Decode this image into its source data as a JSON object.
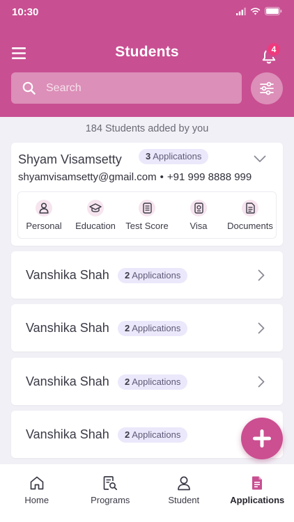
{
  "status_bar": {
    "time": "10:30"
  },
  "header": {
    "title": "Students",
    "notification_count": "4",
    "search": {
      "placeholder": "Search",
      "value": ""
    }
  },
  "summary": {
    "text": "184 Students added by you"
  },
  "expanded_student": {
    "name": "Shyam Visamsetty",
    "apps_count": "3",
    "apps_label": "Applications",
    "email": "shyamvisamsetty@gmail.com",
    "separator": "•",
    "phone": "+91 999 8888 999",
    "sections": [
      {
        "label": "Personal",
        "icon": "person-icon"
      },
      {
        "label": "Education",
        "icon": "graduation-cap-icon"
      },
      {
        "label": "Test Score",
        "icon": "test-score-icon"
      },
      {
        "label": "Visa",
        "icon": "visa-icon"
      },
      {
        "label": "Documents",
        "icon": "documents-icon"
      }
    ]
  },
  "students": [
    {
      "name": "Vanshika Shah",
      "apps_count": "2",
      "apps_label": "Applications"
    },
    {
      "name": "Vanshika Shah",
      "apps_count": "2",
      "apps_label": "Applications"
    },
    {
      "name": "Vanshika Shah",
      "apps_count": "2",
      "apps_label": "Applications"
    },
    {
      "name": "Vanshika Shah",
      "apps_count": "2",
      "apps_label": "Applications"
    }
  ],
  "bottom_nav": [
    {
      "label": "Home",
      "icon": "home-icon",
      "active": false
    },
    {
      "label": "Programs",
      "icon": "programs-icon",
      "active": false
    },
    {
      "label": "Student",
      "icon": "student-icon",
      "active": false
    },
    {
      "label": "Applications",
      "icon": "applications-icon",
      "active": true
    }
  ],
  "colors": {
    "primary": "#c84f92",
    "badge": "#ee3a7d",
    "pill_bg": "#ece8fb",
    "background": "#f1f0f6"
  }
}
